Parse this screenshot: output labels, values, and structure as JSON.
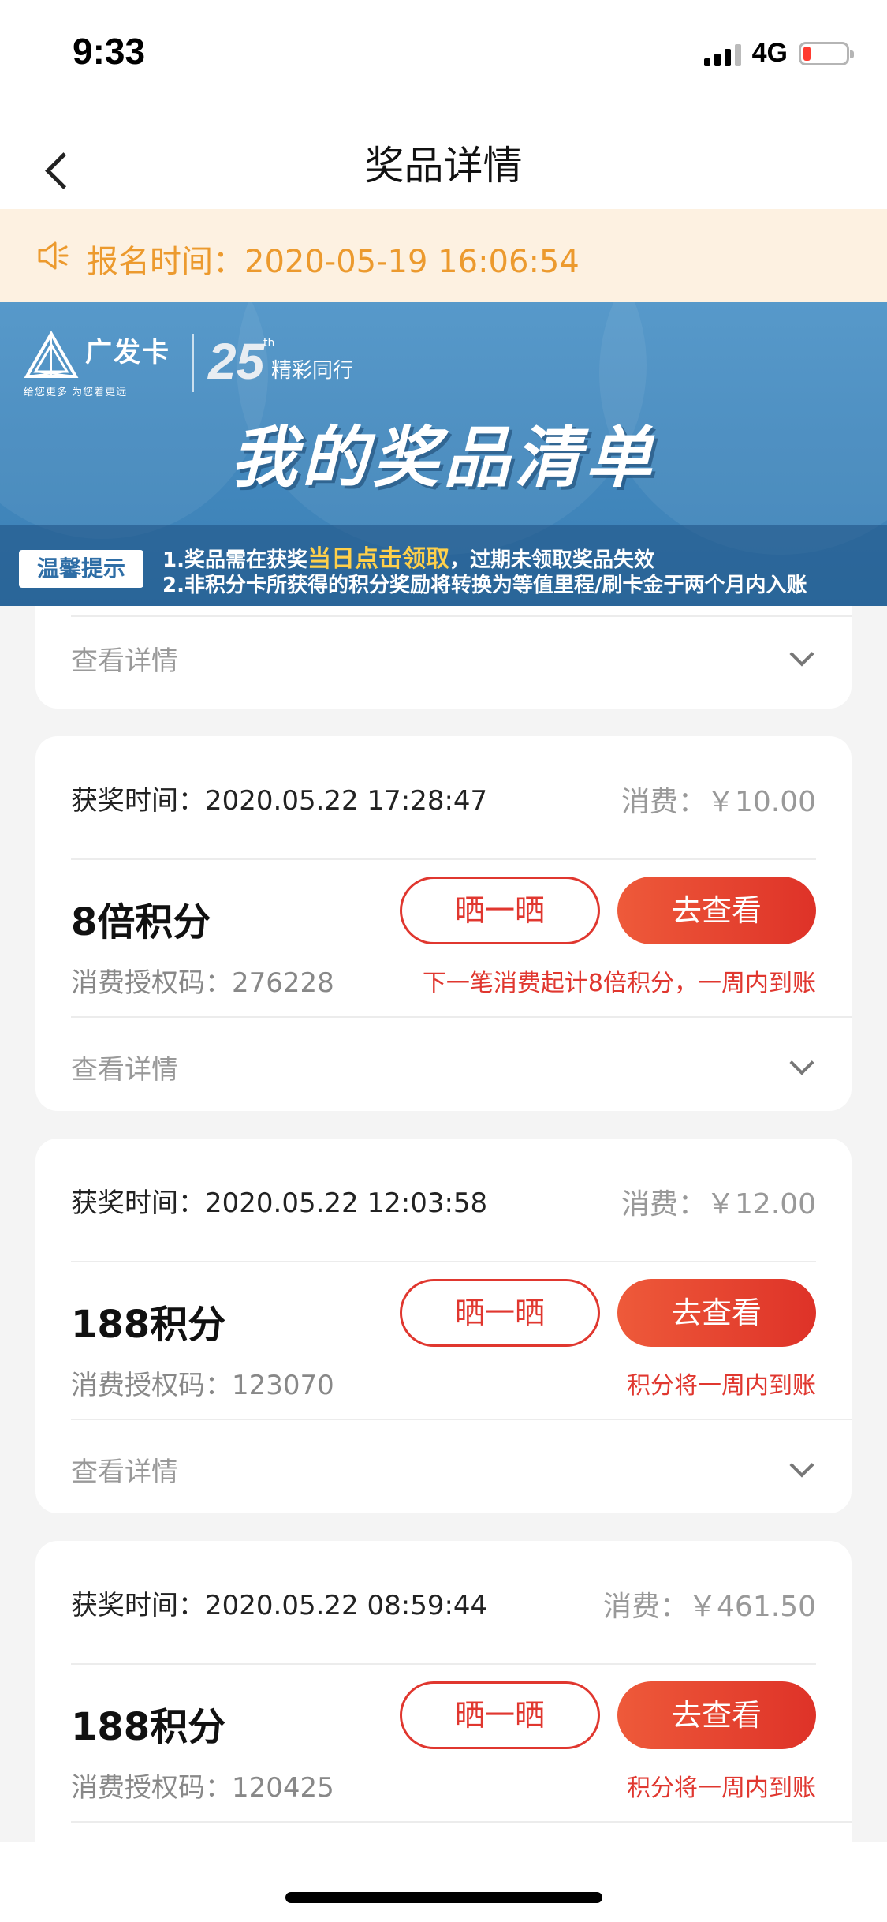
{
  "status_bar": {
    "time": "9:33",
    "network": "4G"
  },
  "nav": {
    "title": "奖品详情"
  },
  "notice": {
    "text": "报名时间：2020-05-19 16:06:54"
  },
  "banner": {
    "brand": "广发卡",
    "slogan": "给您更多  为您着更远",
    "anniversary_number": "25",
    "anniversary_suffix": "th",
    "anniversary_text": "精彩同行",
    "title": "我的奖品清单",
    "tip_badge": "温馨提示",
    "tip1_prefix": "1.奖品需在获奖",
    "tip1_highlight": "当日点击领取",
    "tip1_suffix": "，过期未领取奖品失效",
    "tip2": "2.非积分卡所获得的积分奖励将转换为等值里程/刷卡金于两个月内入账"
  },
  "partial_card": {
    "detail_label": "查看详情"
  },
  "cards": [
    {
      "win_time": "获奖时间：2020.05.22 17:28:47",
      "spend": "消费：￥10.00",
      "prize": "8倍积分",
      "auth_code": "消费授权码：276228",
      "note": "下一笔消费起计8倍积分，一周内到账",
      "share_label": "晒一晒",
      "view_label": "去查看",
      "detail_label": "查看详情"
    },
    {
      "win_time": "获奖时间：2020.05.22 12:03:58",
      "spend": "消费：￥12.00",
      "prize": "188积分",
      "auth_code": "消费授权码：123070",
      "note": "积分将一周内到账",
      "share_label": "晒一晒",
      "view_label": "去查看",
      "detail_label": "查看详情"
    },
    {
      "win_time": "获奖时间：2020.05.22 08:59:44",
      "spend": "消费：￥461.50",
      "prize": "188积分",
      "auth_code": "消费授权码：120425",
      "note": "积分将一周内到账",
      "share_label": "晒一晒",
      "view_label": "去查看"
    }
  ],
  "colors": {
    "accent_red": "#e0372f",
    "notice_orange": "#ec9a2e",
    "banner_blue": "#4d93c7"
  }
}
